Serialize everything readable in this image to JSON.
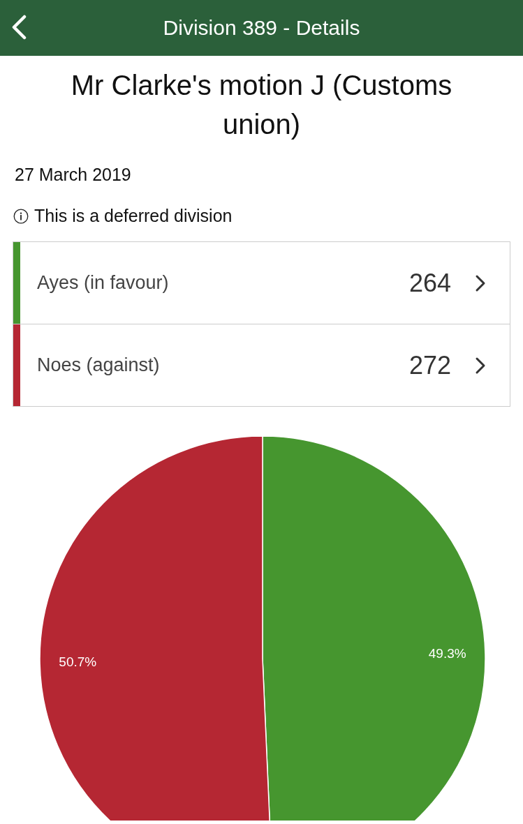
{
  "header": {
    "title": "Division 389 - Details"
  },
  "title": "Mr Clarke's motion J (Customs union)",
  "date": "27 March 2019",
  "notice": "This is a deferred division",
  "votes": [
    {
      "label": "Ayes (in favour)",
      "count": "264",
      "color": "#46962f"
    },
    {
      "label": "Noes (against)",
      "count": "272",
      "color": "#b52733"
    }
  ],
  "chart_data": {
    "type": "pie",
    "values": [
      49.3,
      50.7
    ],
    "value_labels": [
      "49.3%",
      "50.7%"
    ]
  }
}
